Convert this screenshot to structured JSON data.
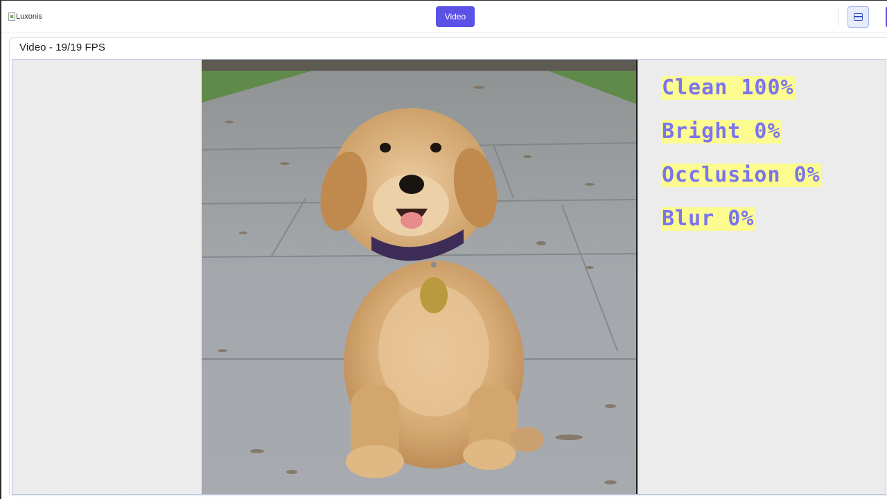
{
  "header": {
    "logo_alt": "Luxonis",
    "tab_label": "Video"
  },
  "panel": {
    "title": "Video - 19/19 FPS"
  },
  "overlay": {
    "lines": [
      "Clean 100%",
      "Bright 0%",
      "Occlusion 0%",
      "Blur 0%"
    ],
    "text_color": "#7b74ee",
    "highlight_color": "#fbfb8f"
  },
  "colors": {
    "accent": "#5b51e6"
  },
  "icons": {
    "layout": "layout-split-icon"
  }
}
